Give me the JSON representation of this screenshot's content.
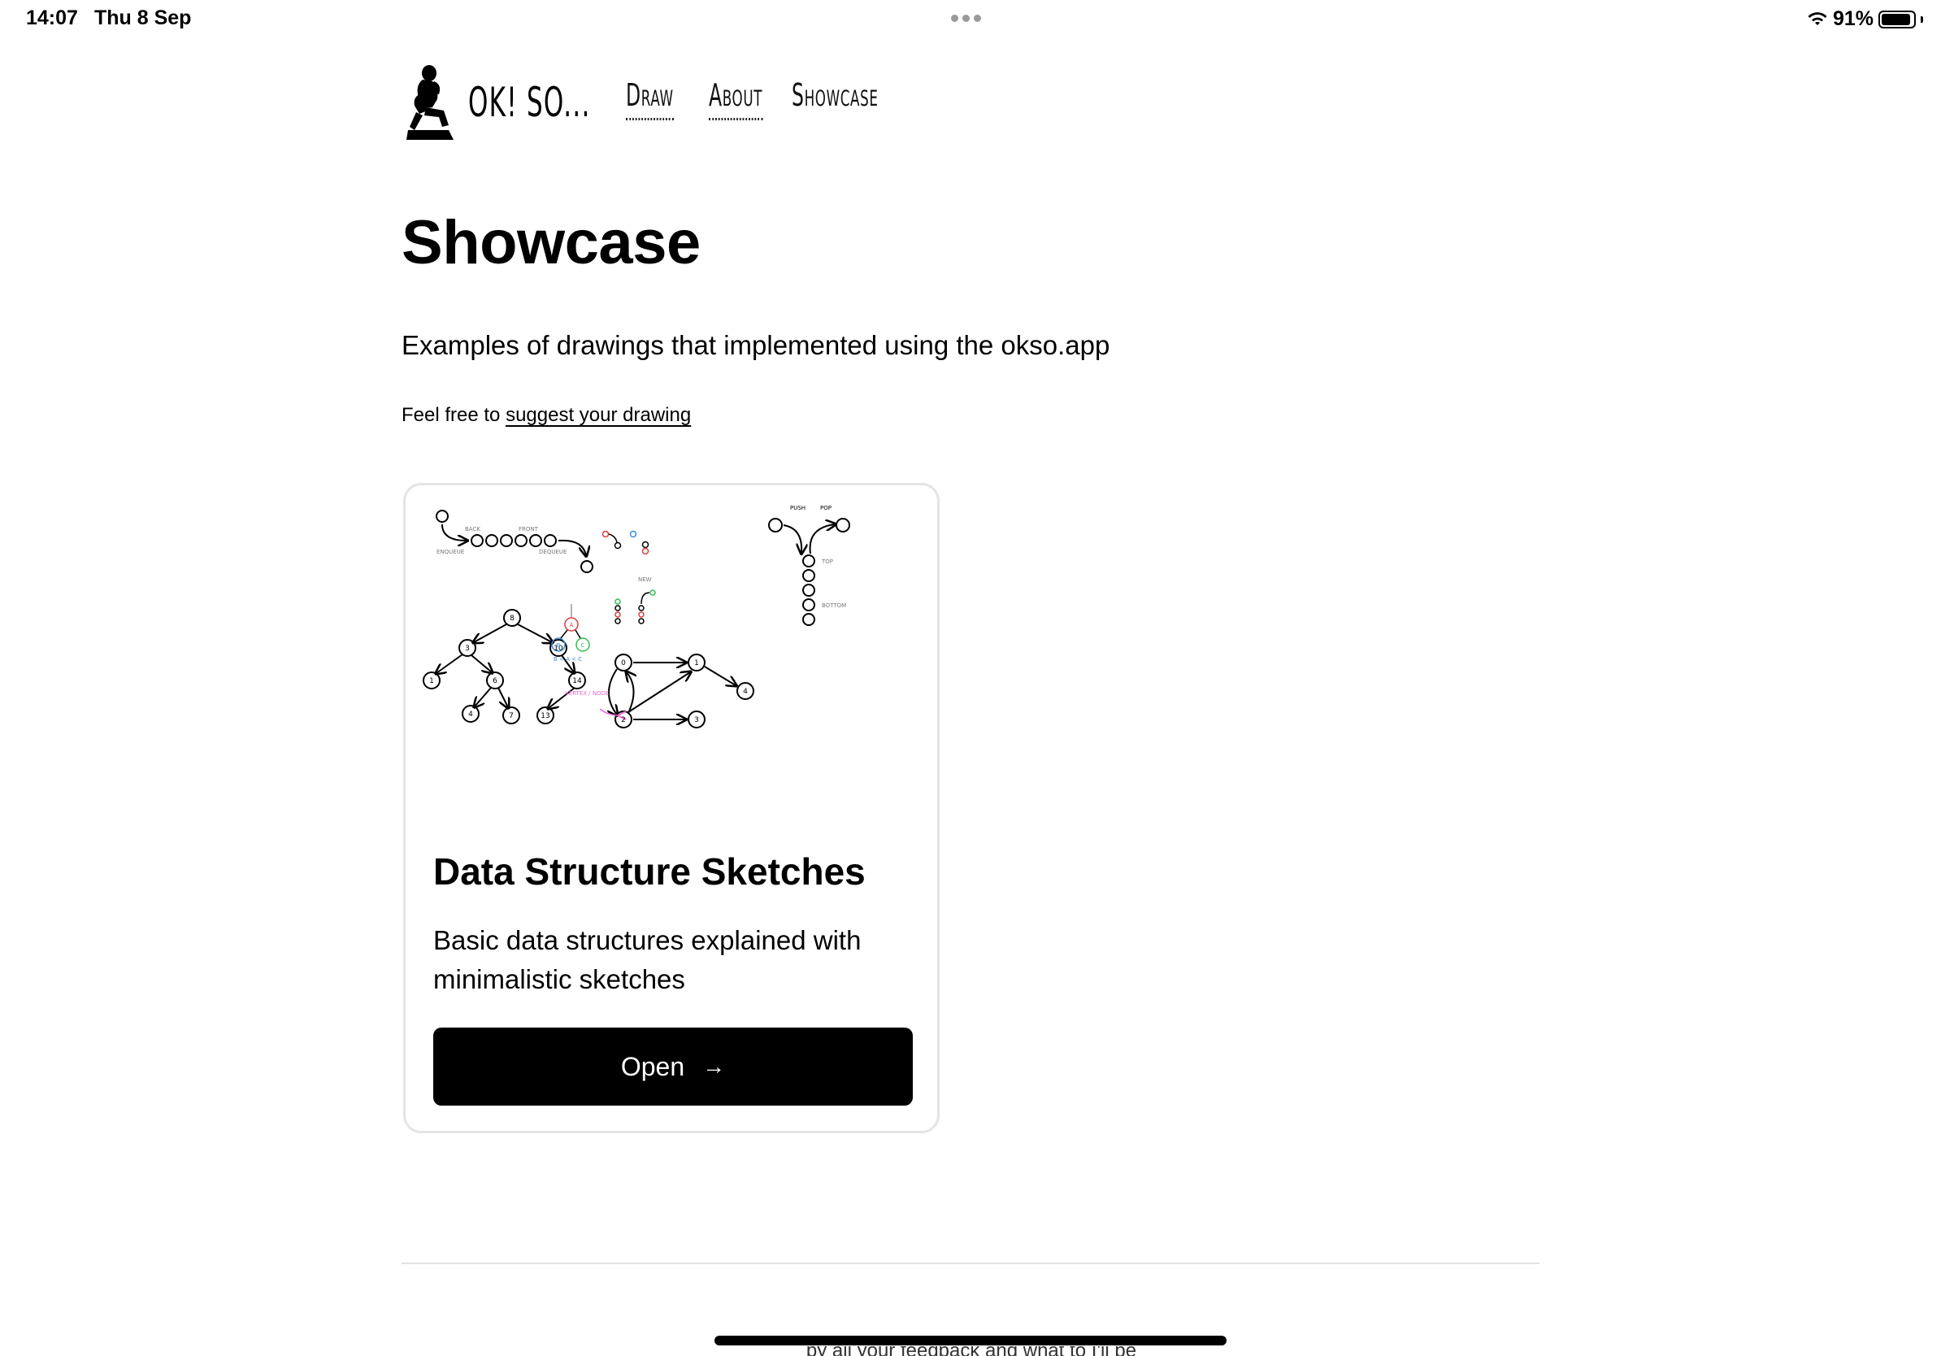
{
  "status_bar": {
    "time": "14:07",
    "date": "Thu 8 Sep",
    "battery_percent": "91%",
    "battery_level": 0.91
  },
  "header": {
    "logo_text": "OK! SO...",
    "nav": [
      {
        "label": "Draw"
      },
      {
        "label": "About"
      },
      {
        "label": "Showcase"
      }
    ]
  },
  "main": {
    "title": "Showcase",
    "subtitle": "Examples of drawings that implemented using the okso.app",
    "suggest_prefix": "Feel free to ",
    "suggest_link": "suggest your drawing"
  },
  "card": {
    "title": "Data Structure Sketches",
    "description": "Basic data structures explained with minimalistic sketches",
    "button_label": "Open",
    "sketch_labels": {
      "enqueue": "ENQUEUE",
      "dequeue": "DEQUEUE",
      "back": "BACK",
      "front": "FRONT",
      "push": "PUSH",
      "pop": "POP",
      "top": "TOP",
      "bottom": "BOTTOM",
      "vertex": "VERTEX / NODE",
      "order": "B < A < C",
      "new_label": "NEW",
      "tree_nodes": [
        "8",
        "3",
        "10",
        "1",
        "6",
        "14",
        "4",
        "7",
        "13"
      ],
      "bst_nodes": [
        "A",
        "B",
        "C"
      ],
      "graph_nodes": [
        "0",
        "1",
        "2",
        "3",
        "4"
      ]
    }
  },
  "footer": {
    "partial_text": "by ail your feedback and what to I'll be"
  },
  "colors": {
    "accent_red": "#e23b3b",
    "accent_blue": "#3a8be0",
    "accent_green": "#2fbf4f",
    "accent_pink": "#e86ad6"
  }
}
